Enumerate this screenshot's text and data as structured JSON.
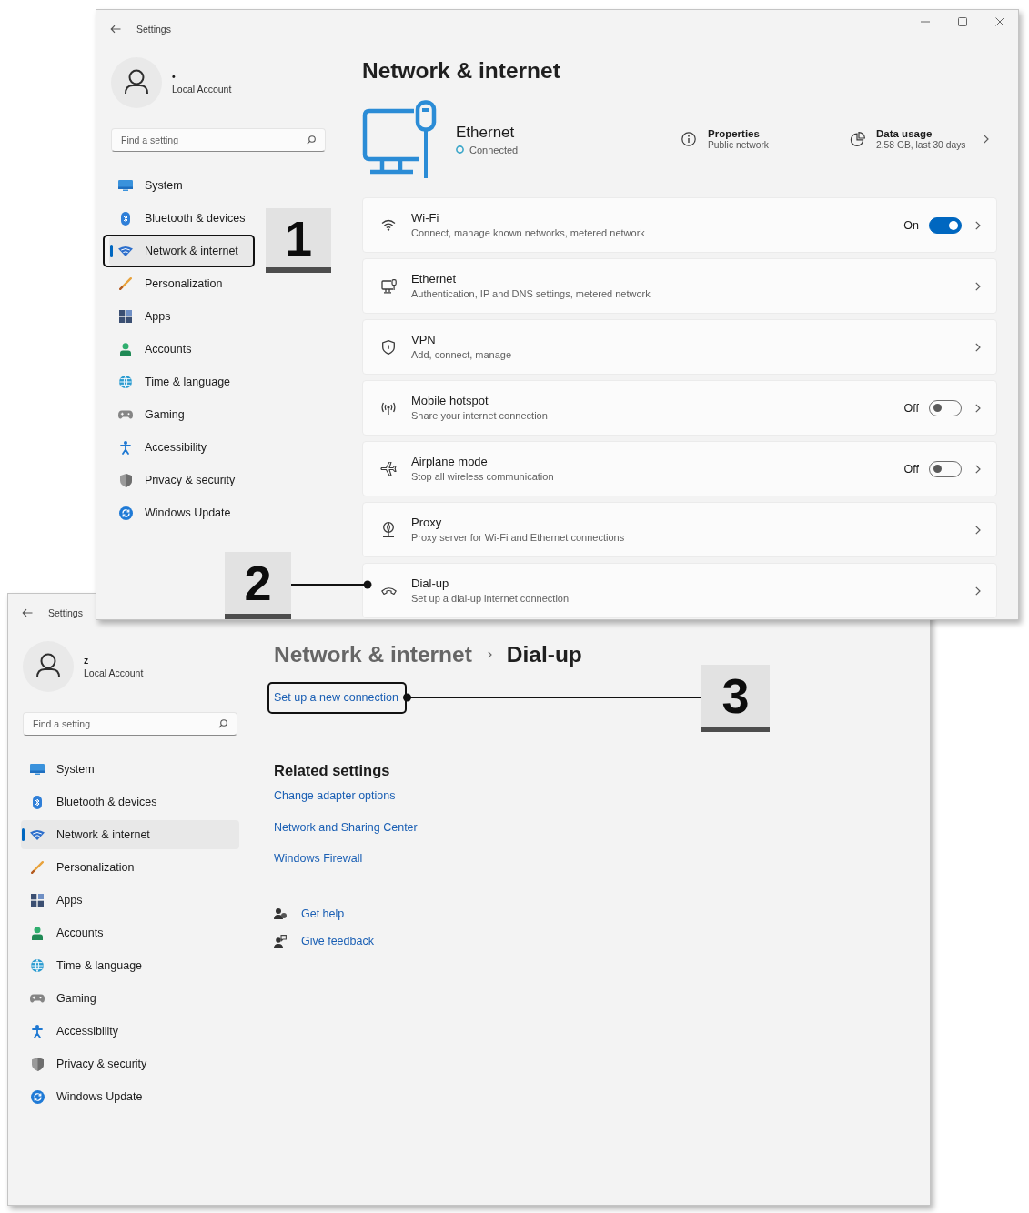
{
  "windows": [
    {
      "title": "Settings",
      "controls": true,
      "account": {
        "name": "•",
        "type": "Local Account"
      },
      "search": {
        "placeholder": "Find a setting"
      },
      "nav": [
        {
          "label": "System",
          "selected": false
        },
        {
          "label": "Bluetooth & devices",
          "selected": false
        },
        {
          "label": "Network & internet",
          "selected": true
        },
        {
          "label": "Personalization",
          "selected": false
        },
        {
          "label": "Apps",
          "selected": false
        },
        {
          "label": "Accounts",
          "selected": false
        },
        {
          "label": "Time & language",
          "selected": false
        },
        {
          "label": "Gaming",
          "selected": false
        },
        {
          "label": "Accessibility",
          "selected": false
        },
        {
          "label": "Privacy & security",
          "selected": false
        },
        {
          "label": "Windows Update",
          "selected": false
        }
      ],
      "page": {
        "kind": "overview",
        "heading": "Network & internet",
        "connection": {
          "name": "Ethernet",
          "status": "Connected"
        },
        "properties": {
          "title": "Properties",
          "subtitle": "Public network"
        },
        "data_usage": {
          "title": "Data usage",
          "subtitle": "2.58 GB, last 30 days"
        },
        "rows": [
          {
            "kind": "toggle",
            "title": "Wi-Fi",
            "subtitle": "Connect, manage known networks, metered network",
            "state_label": "On",
            "on": true
          },
          {
            "kind": "link",
            "title": "Ethernet",
            "subtitle": "Authentication, IP and DNS settings, metered network"
          },
          {
            "kind": "link",
            "title": "VPN",
            "subtitle": "Add, connect, manage"
          },
          {
            "kind": "toggle",
            "title": "Mobile hotspot",
            "subtitle": "Share your internet connection",
            "state_label": "Off",
            "on": false
          },
          {
            "kind": "toggle",
            "title": "Airplane mode",
            "subtitle": "Stop all wireless communication",
            "state_label": "Off",
            "on": false
          },
          {
            "kind": "link",
            "title": "Proxy",
            "subtitle": "Proxy server for Wi-Fi and Ethernet connections"
          },
          {
            "kind": "link",
            "title": "Dial-up",
            "subtitle": "Set up a dial-up internet connection"
          }
        ]
      }
    },
    {
      "title": "Settings",
      "account": {
        "name": "z",
        "type": "Local Account"
      },
      "search": {
        "placeholder": "Find a setting"
      },
      "nav": [
        {
          "label": "System",
          "selected": false
        },
        {
          "label": "Bluetooth & devices",
          "selected": false
        },
        {
          "label": "Network & internet",
          "selected": true
        },
        {
          "label": "Personalization",
          "selected": false
        },
        {
          "label": "Apps",
          "selected": false
        },
        {
          "label": "Accounts",
          "selected": false
        },
        {
          "label": "Time & language",
          "selected": false
        },
        {
          "label": "Gaming",
          "selected": false
        },
        {
          "label": "Accessibility",
          "selected": false
        },
        {
          "label": "Privacy & security",
          "selected": false
        },
        {
          "label": "Windows Update",
          "selected": false
        }
      ],
      "page": {
        "kind": "dial_up",
        "breadcrumb": [
          {
            "label": "Network & internet"
          },
          {
            "label": "Dial-up"
          }
        ],
        "action_link": "Set up a new connection",
        "related_heading": "Related settings",
        "related_links": [
          "Change adapter options",
          "Network and Sharing Center",
          "Windows Firewall"
        ],
        "help_links": [
          "Get help",
          "Give feedback"
        ]
      }
    }
  ],
  "callouts": [
    {
      "label": "1"
    },
    {
      "label": "2"
    },
    {
      "label": "3"
    }
  ]
}
